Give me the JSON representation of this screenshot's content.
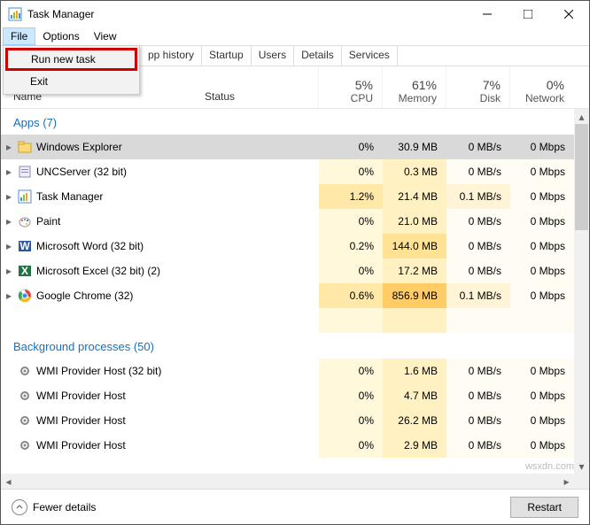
{
  "window": {
    "title": "Task Manager"
  },
  "menu": {
    "file": "File",
    "options": "Options",
    "view": "View"
  },
  "dropdown": {
    "run": "Run new task",
    "exit": "Exit"
  },
  "tabs": {
    "apphistory": "pp history",
    "startup": "Startup",
    "users": "Users",
    "details": "Details",
    "services": "Services"
  },
  "columns": {
    "name": "Name",
    "status": "Status",
    "cpu": {
      "pct": "5%",
      "label": "CPU"
    },
    "mem": {
      "pct": "61%",
      "label": "Memory"
    },
    "disk": {
      "pct": "7%",
      "label": "Disk"
    },
    "net": {
      "pct": "0%",
      "label": "Network"
    }
  },
  "groups": {
    "apps": "Apps (7)",
    "bg": "Background processes (50)"
  },
  "rows": [
    {
      "name": "Windows Explorer",
      "cpu": "0%",
      "mem": "30.9 MB",
      "disk": "0 MB/s",
      "net": "0 Mbps",
      "sel": true,
      "icon": "folder"
    },
    {
      "name": "UNCServer (32 bit)",
      "cpu": "0%",
      "mem": "0.3 MB",
      "disk": "0 MB/s",
      "net": "0 Mbps",
      "icon": "generic"
    },
    {
      "name": "Task Manager",
      "cpu": "1.2%",
      "mem": "21.4 MB",
      "disk": "0.1 MB/s",
      "net": "0 Mbps",
      "icon": "tm",
      "cpuH": true,
      "diskH": true
    },
    {
      "name": "Paint",
      "cpu": "0%",
      "mem": "21.0 MB",
      "disk": "0 MB/s",
      "net": "0 Mbps",
      "icon": "paint"
    },
    {
      "name": "Microsoft Word (32 bit)",
      "cpu": "0.2%",
      "mem": "144.0 MB",
      "disk": "0 MB/s",
      "net": "0 Mbps",
      "icon": "word",
      "memH": true
    },
    {
      "name": "Microsoft Excel (32 bit) (2)",
      "cpu": "0%",
      "mem": "17.2 MB",
      "disk": "0 MB/s",
      "net": "0 Mbps",
      "icon": "excel"
    },
    {
      "name": "Google Chrome (32)",
      "cpu": "0.6%",
      "mem": "856.9 MB",
      "disk": "0.1 MB/s",
      "net": "0 Mbps",
      "icon": "chrome",
      "cpuH": true,
      "memHH": true,
      "diskH": true
    }
  ],
  "bgrows": [
    {
      "name": "WMI Provider Host (32 bit)",
      "cpu": "0%",
      "mem": "1.6 MB",
      "disk": "0 MB/s",
      "net": "0 Mbps"
    },
    {
      "name": "WMI Provider Host",
      "cpu": "0%",
      "mem": "4.7 MB",
      "disk": "0 MB/s",
      "net": "0 Mbps"
    },
    {
      "name": "WMI Provider Host",
      "cpu": "0%",
      "mem": "26.2 MB",
      "disk": "0 MB/s",
      "net": "0 Mbps"
    },
    {
      "name": "WMI Provider Host",
      "cpu": "0%",
      "mem": "2.9 MB",
      "disk": "0 MB/s",
      "net": "0 Mbps"
    }
  ],
  "footer": {
    "fewer": "Fewer details",
    "restart": "Restart"
  },
  "watermark": "wsxdn.com"
}
